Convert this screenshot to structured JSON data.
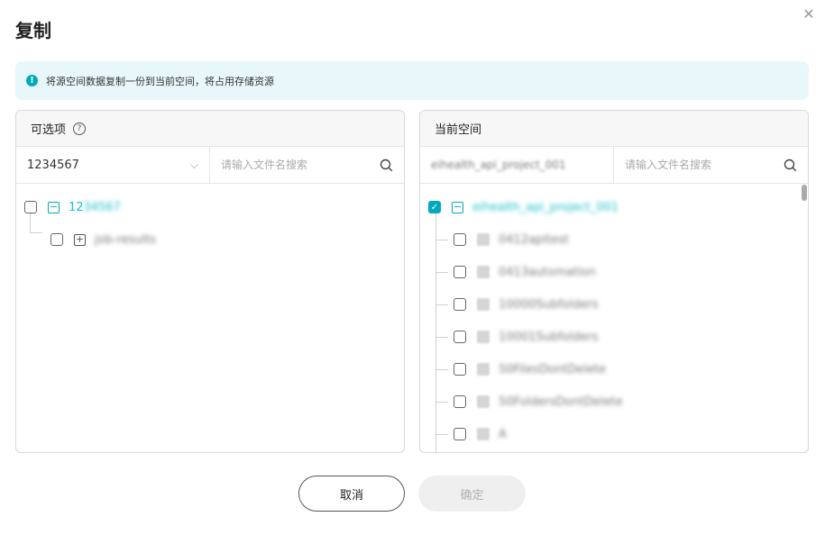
{
  "dialog": {
    "title": "复制",
    "close_icon": "close-icon"
  },
  "notice": {
    "icon": "info-icon",
    "text": "将源空间数据复制一份到当前空间，将占用存储资源"
  },
  "left_panel": {
    "header": "可选项",
    "help_icon": "help-icon",
    "select_value": "1234567",
    "search_placeholder": "请输入文件名搜索",
    "tree": [
      {
        "label": "1234567",
        "expanded": true,
        "checked": false
      },
      {
        "label": "job-results",
        "expanded": false,
        "checked": false
      }
    ]
  },
  "right_panel": {
    "header": "当前空间",
    "select_value": "eihealth_api_project_001",
    "search_placeholder": "请输入文件名搜索",
    "root": {
      "label": "eihealth_api_project_001",
      "checked": true
    },
    "items": [
      {
        "label": "0412apitest",
        "checked": false
      },
      {
        "label": "0413automation",
        "checked": false
      },
      {
        "label": "10000Subfolders",
        "checked": false
      },
      {
        "label": "10001Subfolders",
        "checked": false
      },
      {
        "label": "50FilesDontDelete",
        "checked": false
      },
      {
        "label": "50FoldersDontDelete",
        "checked": false
      },
      {
        "label": "A",
        "checked": false
      }
    ]
  },
  "buttons": {
    "cancel": "取消",
    "ok": "确定"
  },
  "colors": {
    "accent": "#00aaba",
    "notice_bg": "#e8f8fa",
    "disabled_bg": "#efefef"
  }
}
